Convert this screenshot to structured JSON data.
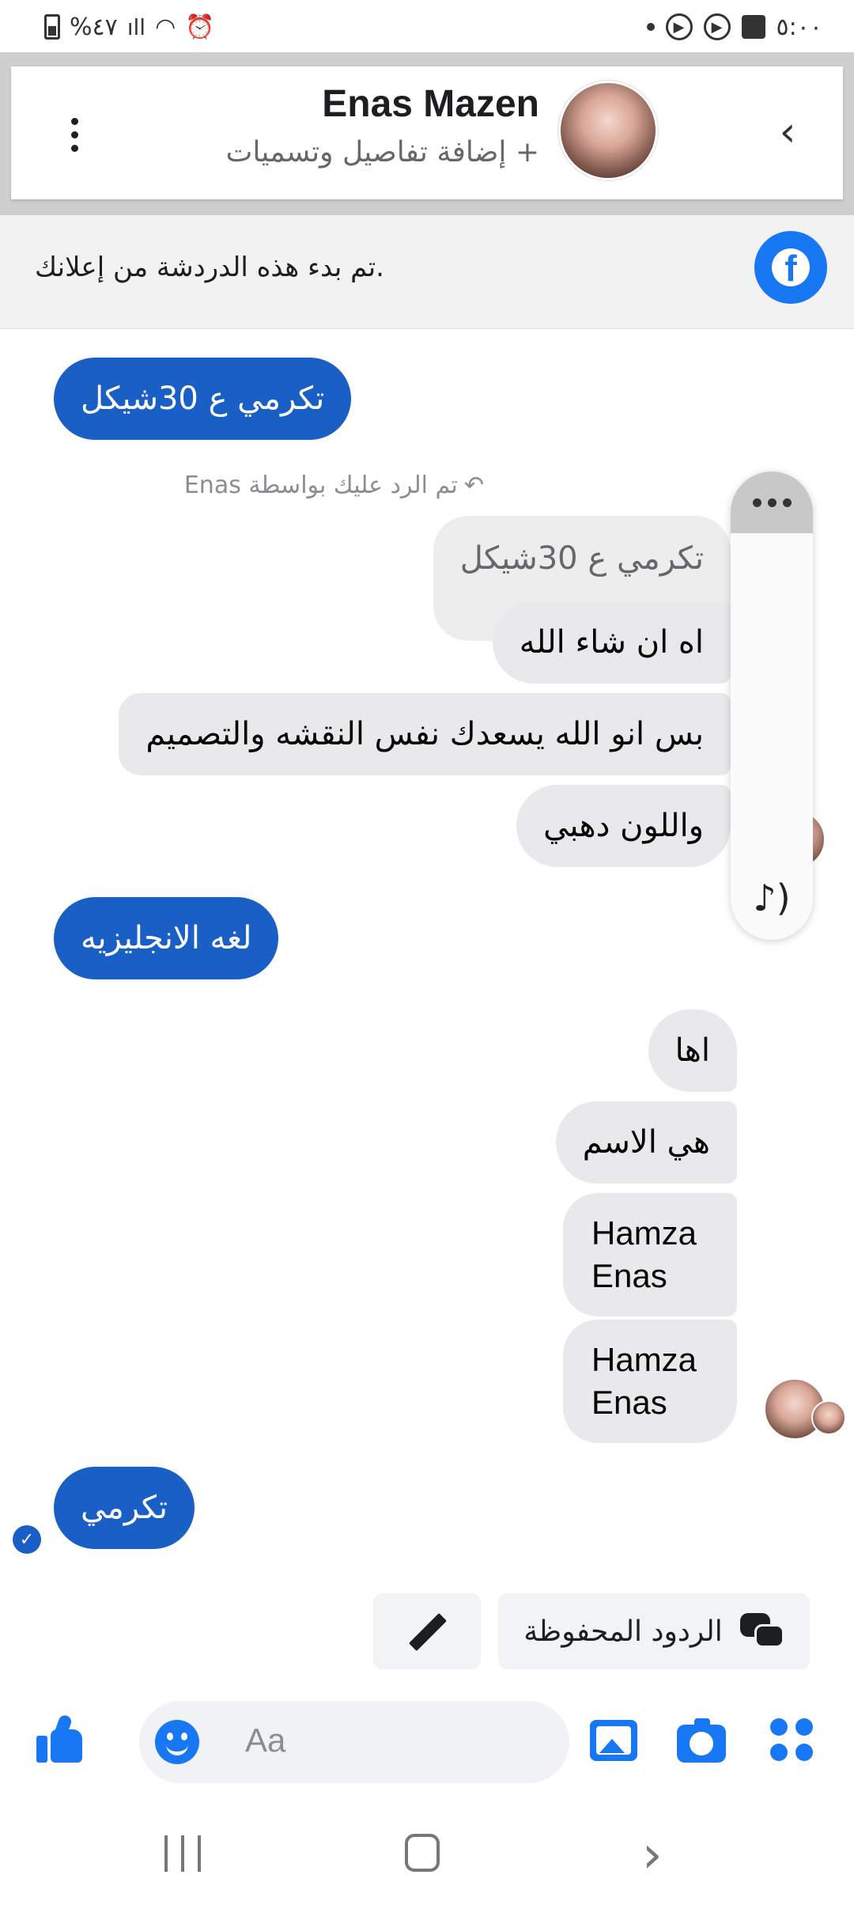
{
  "status_bar": {
    "battery_text": "%٤٧",
    "time": "٥:٠٠"
  },
  "header": {
    "contact_name": "Enas Mazen",
    "subtitle": "+ إضافة تفاصيل وتسميات"
  },
  "ad_banner": {
    "text": ".تم بدء هذه الدردشة من إعلانك"
  },
  "messages": {
    "m1": "تكرمي ع 30شيكل",
    "reply_label": "تم الرد عليك بواسطة Enas",
    "quoted": "تكرمي ع 30شيكل",
    "m2": "اه ان شاء الله",
    "m3": "بس انو الله يسعدك نفس النقشه والتصميم",
    "m4": "واللون دهبي",
    "m5": "لغه الانجليزيه",
    "m6": "اها",
    "m7": "هي الاسم",
    "m8": "Hamza Enas",
    "m9": "Hamza Enas",
    "m10": "تكرمي"
  },
  "quick_actions": {
    "saved_replies": "الردود المحفوظة"
  },
  "composer": {
    "placeholder": "Aa"
  },
  "colors": {
    "accent": "#1877f2",
    "outgoing_bubble": "#1a5fc6",
    "incoming_bubble": "#e9e9eb"
  }
}
